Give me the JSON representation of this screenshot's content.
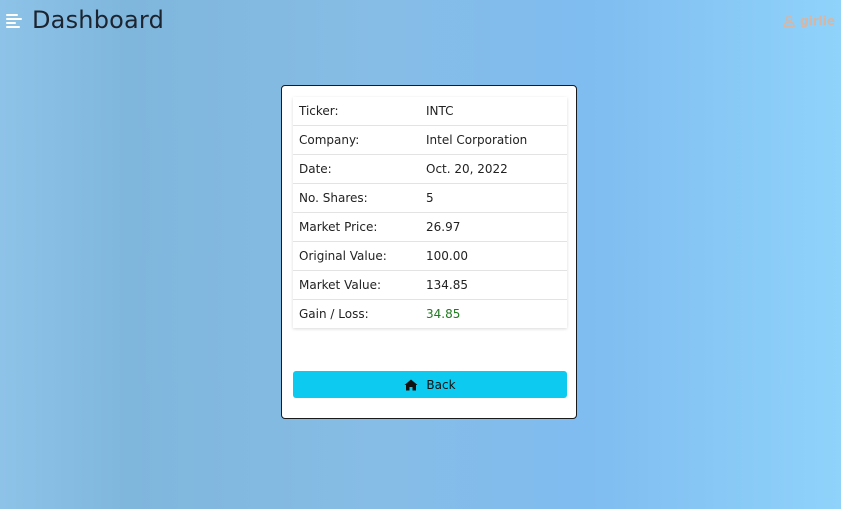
{
  "header": {
    "title": "Dashboard",
    "username": "girlie"
  },
  "details": [
    {
      "key": "Ticker:",
      "value": "INTC"
    },
    {
      "key": "Company:",
      "value": "Intel Corporation"
    },
    {
      "key": "Date:",
      "value": "Oct. 20, 2022"
    },
    {
      "key": "No. Shares:",
      "value": "5"
    },
    {
      "key": "Market Price:",
      "value": "26.97"
    },
    {
      "key": "Original Value:",
      "value": "100.00"
    },
    {
      "key": "Market Value:",
      "value": "134.85"
    },
    {
      "key": "Gain / Loss:",
      "value": "34.85"
    }
  ],
  "actions": {
    "back_label": "Back"
  },
  "colors": {
    "button": "#0dcaf0",
    "gain": "#1f7a1f"
  }
}
